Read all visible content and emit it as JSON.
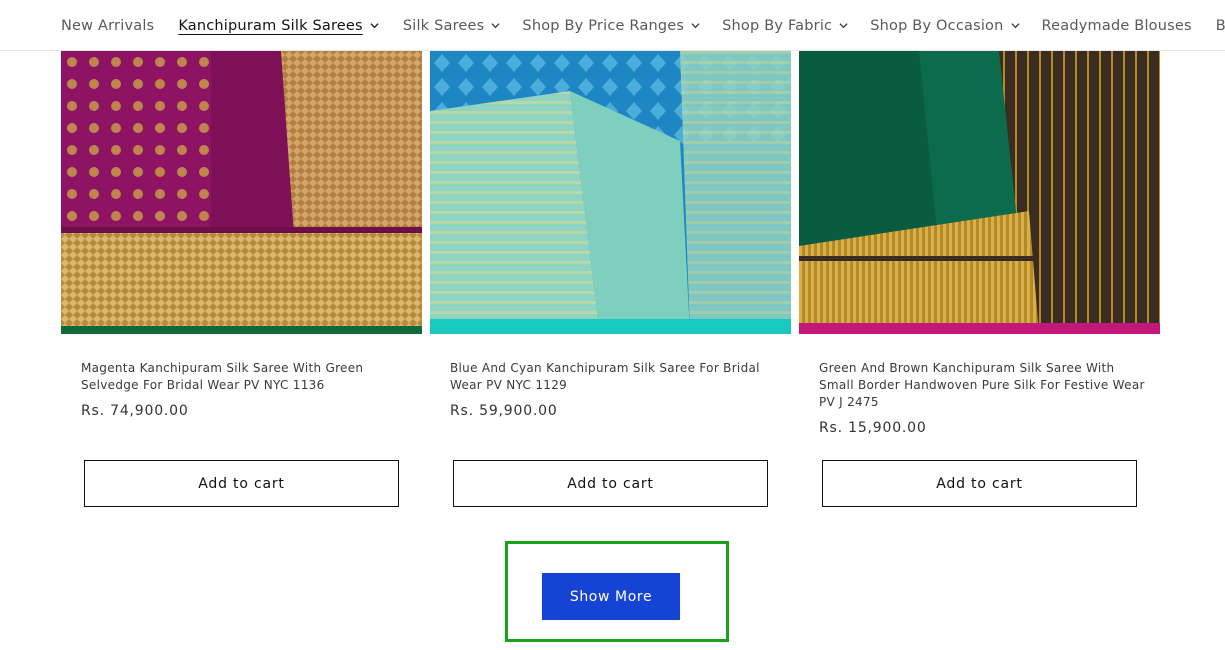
{
  "nav": {
    "items": [
      {
        "label": "New Arrivals",
        "has_dropdown": false,
        "active": false
      },
      {
        "label": "Kanchipuram Silk Sarees",
        "has_dropdown": true,
        "active": true
      },
      {
        "label": "Silk Sarees",
        "has_dropdown": true,
        "active": false
      },
      {
        "label": "Shop By Price Ranges",
        "has_dropdown": true,
        "active": false
      },
      {
        "label": "Shop By Fabric",
        "has_dropdown": true,
        "active": false
      },
      {
        "label": "Shop By Occasion",
        "has_dropdown": true,
        "active": false
      },
      {
        "label": "Readymade Blouses",
        "has_dropdown": false,
        "active": false
      },
      {
        "label": "Blog",
        "has_dropdown": false,
        "active": false
      }
    ]
  },
  "products": [
    {
      "title": "Magenta Kanchipuram Silk Saree With Green Selvedge For Bridal Wear PV NYC 1136",
      "price": "Rs. 74,900.00",
      "button": "Add to cart",
      "colors": {
        "body": "#8e1463",
        "border": "#c9a04a",
        "selvedge": "#0f6b3a"
      }
    },
    {
      "title": "Blue And Cyan Kanchipuram Silk Saree For Bridal Wear PV NYC 1129",
      "price": "Rs. 59,900.00",
      "button": "Add to cart",
      "colors": {
        "body": "#1f86c4",
        "border": "#8fd3c2",
        "selvedge": "#19c9c0"
      }
    },
    {
      "title": "Green And Brown Kanchipuram Silk Saree With Small Border Handwoven Pure Silk For Festive Wear PV J 2475",
      "price": "Rs. 15,900.00",
      "button": "Add to cart",
      "colors": {
        "body": "#0c6b4c",
        "border": "#c99a2e",
        "selvedge": "#c2187a"
      }
    }
  ],
  "show_more": {
    "label": "Show More"
  },
  "theme": {
    "accent": "#1544d4",
    "highlight": "#1aa21a"
  }
}
